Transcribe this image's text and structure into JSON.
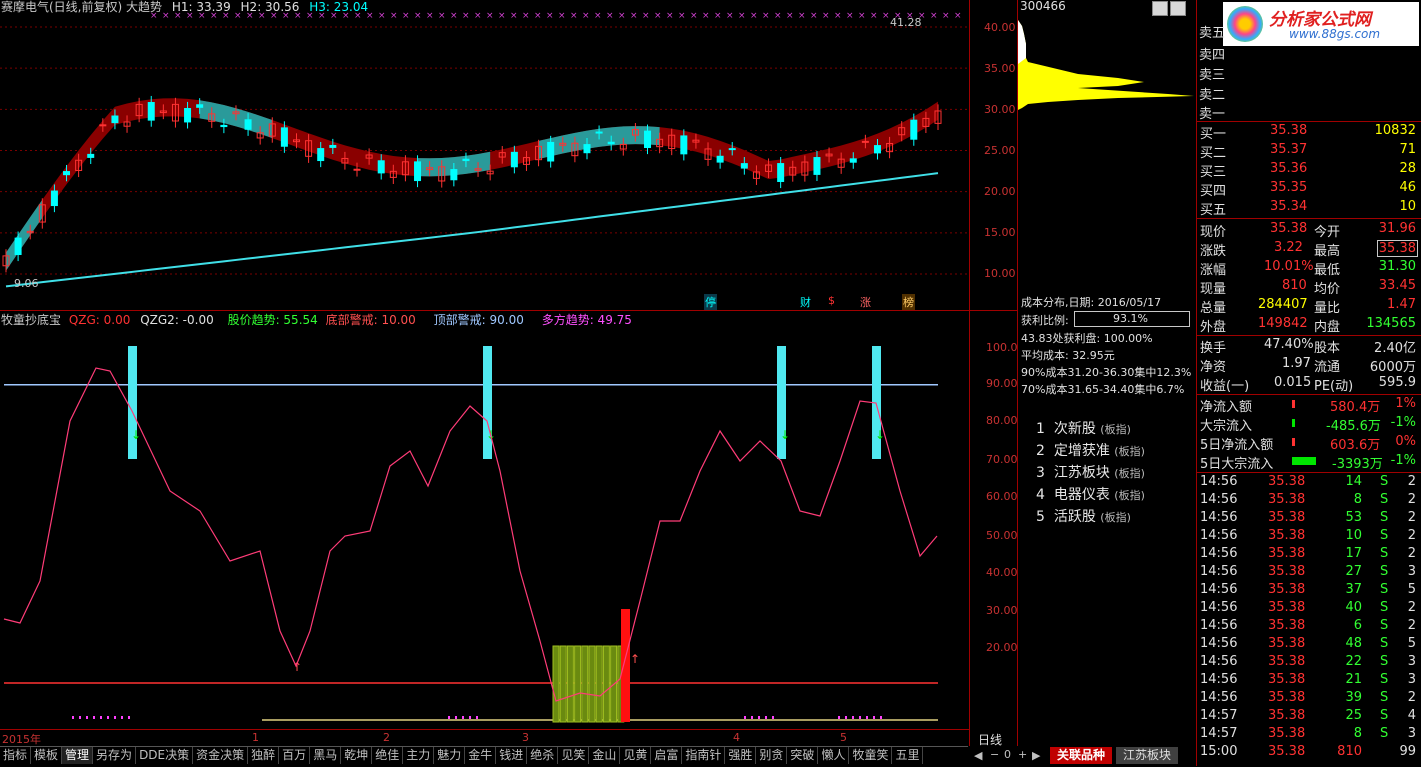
{
  "chart_header": {
    "title": "赛摩电气(日线,前复权) 大趋势",
    "h1": "H1: 33.39",
    "h2": "H2: 30.56",
    "h3": "H3: 23.04",
    "high_mark": "41.28",
    "low_mark": "9.06"
  },
  "price_axis": [
    "40.00",
    "35.00",
    "30.00",
    "25.00",
    "20.00",
    "15.00",
    "10.00"
  ],
  "event_marks": [
    "停",
    "财",
    "$",
    "涨",
    "榜"
  ],
  "indicator_header": {
    "name": "牧童抄底宝",
    "qzg": "QZG: 0.00",
    "qzg2": "QZG2: -0.00",
    "trend": "股价趋势: 55.54",
    "bottom": "底部警戒: 10.00",
    "top": "顶部警戒: 90.00",
    "multi": "多方趋势: 49.75"
  },
  "indicator_axis": [
    "100.0",
    "90.00",
    "80.00",
    "70.00",
    "60.00",
    "50.00",
    "40.00",
    "30.00",
    "20.00"
  ],
  "time_axis": [
    "2015年",
    "1",
    "2",
    "3",
    "4",
    "5"
  ],
  "chip": {
    "code": "300466",
    "date": "成本分布,日期: 2016/05/17",
    "profit_label": "获利比例:",
    "profit_value": "93.1%",
    "line1": "43.83处获利盘: 100.00%",
    "line2": "平均成本: 32.95元",
    "line3": "90%成本31.20-36.30集中12.3%",
    "line4": "70%成本31.65-34.40集中6.7%"
  },
  "related": [
    {
      "no": "1",
      "name": "次新股",
      "tag": "(板指)"
    },
    {
      "no": "2",
      "name": "定增获准",
      "tag": "(板指)"
    },
    {
      "no": "3",
      "name": "江苏板块",
      "tag": "(板指)"
    },
    {
      "no": "4",
      "name": "电器仪表",
      "tag": "(板指)"
    },
    {
      "no": "5",
      "name": "活跃股",
      "tag": "(板指)"
    }
  ],
  "watermark": {
    "text": "分析家公式网",
    "url": "www.88gs.com"
  },
  "sell": [
    {
      "label": "卖五"
    },
    {
      "label": "卖四"
    },
    {
      "label": "卖三"
    },
    {
      "label": "卖二"
    },
    {
      "label": "卖一"
    }
  ],
  "buy": [
    {
      "label": "买一",
      "price": "35.38",
      "vol": "10832"
    },
    {
      "label": "买二",
      "price": "35.37",
      "vol": "71"
    },
    {
      "label": "买三",
      "price": "35.36",
      "vol": "28"
    },
    {
      "label": "买四",
      "price": "35.35",
      "vol": "46"
    },
    {
      "label": "买五",
      "price": "35.34",
      "vol": "10"
    }
  ],
  "quote": [
    {
      "l1": "现价",
      "v1": "35.38",
      "l2": "今开",
      "v2": "31.96"
    },
    {
      "l1": "涨跌",
      "v1": "3.22",
      "l2": "最高",
      "v2": "35.38"
    },
    {
      "l1": "涨幅",
      "v1": "10.01%",
      "l2": "最低",
      "v2": "31.30"
    },
    {
      "l1": "现量",
      "v1": "810",
      "l2": "均价",
      "v2": "33.45"
    },
    {
      "l1": "总量",
      "v1": "284407",
      "l2": "量比",
      "v2": "1.47"
    },
    {
      "l1": "外盘",
      "v1": "149842",
      "l2": "内盘",
      "v2": "134565"
    }
  ],
  "fundamentals": [
    {
      "l1": "换手",
      "v1": "47.40%",
      "l2": "股本",
      "v2": "2.40亿"
    },
    {
      "l1": "净资",
      "v1": "1.97",
      "l2": "流通",
      "v2": "6000万"
    },
    {
      "l1": "收益(一)",
      "v1": "0.015",
      "l2": "PE(动)",
      "v2": "595.9"
    }
  ],
  "flows": [
    {
      "label": "净流入额",
      "value": "580.4万",
      "pct": "1%"
    },
    {
      "label": "大宗流入",
      "value": "-485.6万",
      "pct": "-1%"
    },
    {
      "label": "5日净流入额",
      "value": "603.6万",
      "pct": "0%"
    },
    {
      "label": "5日大宗流入",
      "value": "-3393万",
      "pct": "-1%"
    }
  ],
  "ticks": [
    {
      "t": "14:56",
      "p": "35.38",
      "v": "14",
      "s": "S",
      "n": "2"
    },
    {
      "t": "14:56",
      "p": "35.38",
      "v": "8",
      "s": "S",
      "n": "2"
    },
    {
      "t": "14:56",
      "p": "35.38",
      "v": "53",
      "s": "S",
      "n": "2"
    },
    {
      "t": "14:56",
      "p": "35.38",
      "v": "10",
      "s": "S",
      "n": "2"
    },
    {
      "t": "14:56",
      "p": "35.38",
      "v": "17",
      "s": "S",
      "n": "2"
    },
    {
      "t": "14:56",
      "p": "35.38",
      "v": "27",
      "s": "S",
      "n": "3"
    },
    {
      "t": "14:56",
      "p": "35.38",
      "v": "37",
      "s": "S",
      "n": "5"
    },
    {
      "t": "14:56",
      "p": "35.38",
      "v": "40",
      "s": "S",
      "n": "2"
    },
    {
      "t": "14:56",
      "p": "35.38",
      "v": "6",
      "s": "S",
      "n": "2"
    },
    {
      "t": "14:56",
      "p": "35.38",
      "v": "48",
      "s": "S",
      "n": "5"
    },
    {
      "t": "14:56",
      "p": "35.38",
      "v": "22",
      "s": "S",
      "n": "3"
    },
    {
      "t": "14:56",
      "p": "35.38",
      "v": "21",
      "s": "S",
      "n": "3"
    },
    {
      "t": "14:56",
      "p": "35.38",
      "v": "39",
      "s": "S",
      "n": "2"
    },
    {
      "t": "14:57",
      "p": "35.38",
      "v": "25",
      "s": "S",
      "n": "4"
    },
    {
      "t": "14:57",
      "p": "35.38",
      "v": "8",
      "s": "S",
      "n": "3"
    },
    {
      "t": "15:00",
      "p": "35.38",
      "v": "810",
      "s": "",
      "n": "99"
    }
  ],
  "bottom_tabs": [
    "指标",
    "模板",
    "管理",
    "另存为",
    "DDE决策",
    "资金决策",
    "独醉",
    "百万",
    "黑马",
    "乾坤",
    "绝佳",
    "主力",
    "魅力",
    "金牛",
    "钱进",
    "绝杀",
    "见笑",
    "金山",
    "见黄",
    "启富",
    "指南针",
    "强胜",
    "别贪",
    "突破",
    "懒人",
    "牧童笑",
    "五里"
  ],
  "period_label": "日线",
  "right_tabs": {
    "t1": "关联品种",
    "t2": "江苏板块"
  },
  "colors": {
    "up": "#ff3232",
    "down": "#00ffff",
    "yellow": "#ffff00",
    "green": "#00e600",
    "grid": "#a00000"
  }
}
